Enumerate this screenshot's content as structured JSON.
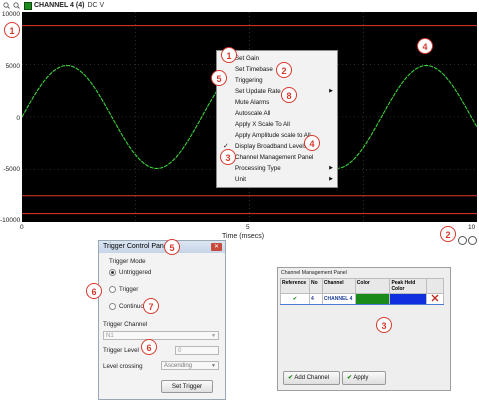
{
  "scope": {
    "channel_label": "CHANNEL 4 (4)",
    "coupling": "DC V",
    "channel_color": "#1c8a1c",
    "y_ticks": [
      "10000",
      "5000",
      "0",
      "-5000",
      "-10000"
    ],
    "x_ticks": [
      "0",
      "5",
      "10"
    ],
    "x_axis_title": "Time (msecs)",
    "icons": [
      "zoom-in-icon",
      "zoom-out-icon"
    ]
  },
  "chart_data": {
    "type": "line",
    "xlabel": "Time (msecs)",
    "ylabel": "",
    "xlim": [
      0,
      10
    ],
    "ylim": [
      -10000,
      10000
    ],
    "grid": "dotted",
    "series": [
      {
        "color": "#3cd23c",
        "x": [
          0,
          0.5,
          1.0,
          1.5,
          2.0,
          2.5,
          3.0,
          3.5,
          4.0,
          4.5,
          5.0,
          5.5,
          6.0,
          6.5,
          7.0,
          7.5,
          8.0,
          8.5,
          9.0,
          9.5,
          10.0
        ],
        "y": [
          0,
          4300,
          4800,
          2200,
          -1800,
          -4500,
          -4900,
          -2700,
          1300,
          4100,
          4900,
          3100,
          -800,
          -3900,
          -5000,
          -3400,
          300,
          3700,
          4900,
          3800,
          300
        ]
      }
    ],
    "reference_lines": [
      {
        "y": 8700,
        "color": "#e03a2a"
      },
      {
        "y": 10200,
        "color": "#e03a2a"
      },
      {
        "y": -7500,
        "color": "#e03a2a"
      },
      {
        "y": -9200,
        "color": "#e03a2a"
      }
    ]
  },
  "context_menu": {
    "items": [
      {
        "label": "Set Gain",
        "submenu": false,
        "checked": false
      },
      {
        "label": "Set Timebase",
        "submenu": false,
        "checked": false
      },
      {
        "label": "Triggering",
        "submenu": false,
        "checked": false
      },
      {
        "label": "Set Update Rate",
        "submenu": true,
        "checked": false
      },
      {
        "label": "Mute Alarms",
        "submenu": false,
        "checked": false
      },
      {
        "label": "Autoscale All",
        "submenu": false,
        "checked": false
      },
      {
        "label": "Apply X Scale To All",
        "submenu": false,
        "checked": false
      },
      {
        "label": "Apply Amplitude scale to All",
        "submenu": false,
        "checked": false
      },
      {
        "label": "Display Broadband Levels",
        "submenu": false,
        "checked": true
      },
      {
        "label": "Channel Management Panel",
        "submenu": false,
        "checked": false
      },
      {
        "label": "Processing Type",
        "submenu": true,
        "checked": false
      },
      {
        "label": "Unit",
        "submenu": true,
        "checked": false
      }
    ]
  },
  "callouts": {
    "c1": "1",
    "c2": "2",
    "c3": "3",
    "c4": "4",
    "c5": "5",
    "c6": "6",
    "c7": "7",
    "c8": "8"
  },
  "trigger_panel": {
    "title": "Trigger Control Panel",
    "close": "✕",
    "mode_label": "Trigger Mode",
    "opt_untriggered": "Untriggered",
    "opt_trigger": "Trigger",
    "opt_continuous": "Continuous",
    "selected_mode": "Untriggered",
    "channel_label": "Trigger Channel",
    "channel_value": "N1",
    "level_label": "Trigger Level",
    "level_value": "0",
    "crossing_label": "Level crossing",
    "crossing_value": "Ascending",
    "set_button": "Set Trigger"
  },
  "channel_panel": {
    "title": "Channel Management Panel",
    "columns": [
      "Reference",
      "No",
      "Channel",
      "Color",
      "Peak Held Color",
      ""
    ],
    "rows": [
      {
        "reference": "✔",
        "no": "4",
        "channel": "CHANNEL 4",
        "color": "#1a8a1a",
        "peak_color": "#1030e0"
      }
    ],
    "add_button": "Add Channel",
    "apply_button": "Apply"
  }
}
